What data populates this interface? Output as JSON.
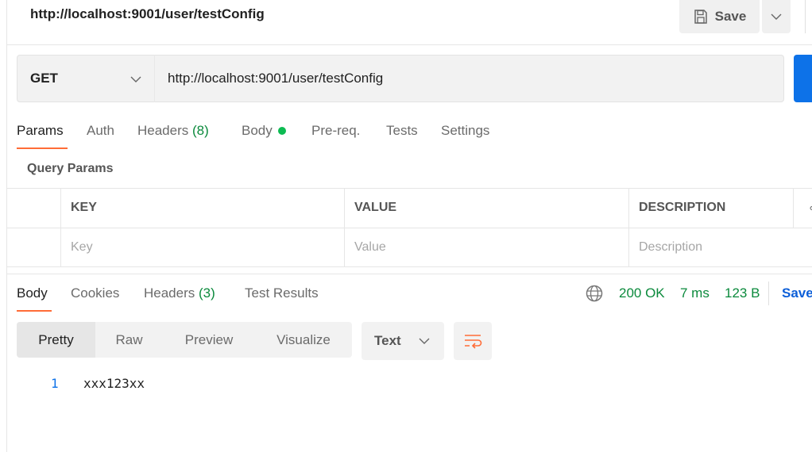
{
  "header": {
    "title": "http://localhost:9001/user/testConfig",
    "save_label": "Save"
  },
  "request": {
    "method": "GET",
    "url": "http://localhost:9001/user/testConfig"
  },
  "request_tabs": [
    {
      "label": "Params",
      "active": true
    },
    {
      "label": "Auth"
    },
    {
      "label": "Headers",
      "count": "(8)"
    },
    {
      "label": "Body",
      "dot_color": "#0cbb52"
    },
    {
      "label": "Pre-req."
    },
    {
      "label": "Tests"
    },
    {
      "label": "Settings"
    }
  ],
  "query_params": {
    "title": "Query Params",
    "columns": [
      "KEY",
      "VALUE",
      "DESCRIPTION"
    ],
    "placeholders": {
      "key": "Key",
      "value": "Value",
      "description": "Description"
    }
  },
  "response_tabs": [
    {
      "label": "Body",
      "active": true
    },
    {
      "label": "Cookies"
    },
    {
      "label": "Headers",
      "count": "(3)"
    },
    {
      "label": "Test Results"
    }
  ],
  "response_status": {
    "status": "200 OK",
    "time": "7 ms",
    "size": "123 B",
    "save_label": "Save"
  },
  "view_modes": {
    "options": [
      "Pretty",
      "Raw",
      "Preview",
      "Visualize"
    ],
    "selected": "Pretty"
  },
  "format": {
    "selected": "Text"
  },
  "response_body": {
    "lines": [
      {
        "number": "1",
        "text": "xxx123xx"
      }
    ]
  },
  "colors": {
    "accent": "#ff6c37",
    "primary": "#0d72e8",
    "success": "#0b8a3c"
  }
}
